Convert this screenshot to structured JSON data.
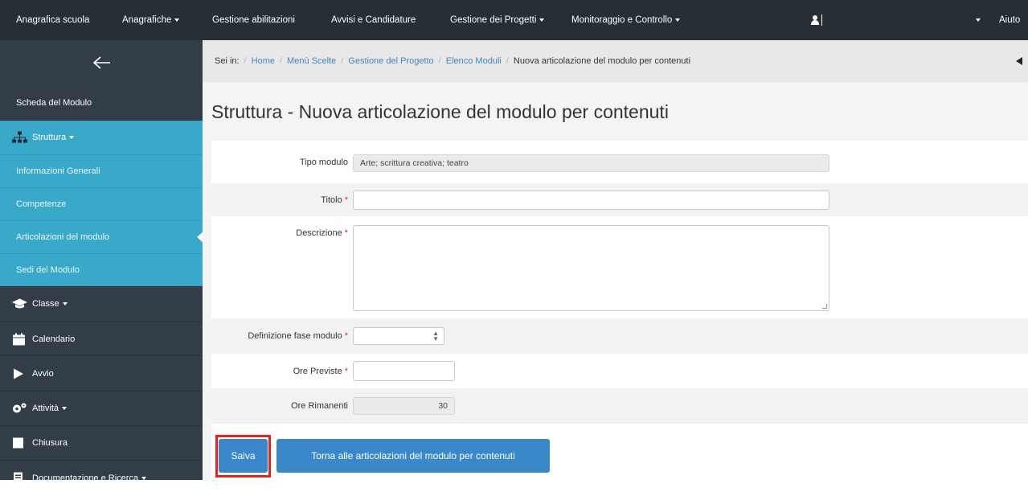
{
  "topnav": {
    "items": [
      {
        "label": "Anagrafica scuola",
        "dropdown": false
      },
      {
        "label": "Anagrafiche",
        "dropdown": true
      },
      {
        "label": "Gestione abilitazioni",
        "dropdown": false
      },
      {
        "label": "Avvisi e Candidature",
        "dropdown": false
      },
      {
        "label": "Gestione dei Progetti",
        "dropdown": true
      },
      {
        "label": "Monitoraggio e Controllo",
        "dropdown": true
      }
    ],
    "help_label": "Aiuto"
  },
  "sidebar": {
    "header_label": "Scheda del Modulo",
    "items": [
      {
        "label": "Struttura",
        "icon": "sitemap-icon",
        "dropdown": true
      },
      {
        "label": "Informazioni Generali"
      },
      {
        "label": "Competenze"
      },
      {
        "label": "Articolazioni del modulo"
      },
      {
        "label": "Sedi del Modulo"
      },
      {
        "label": "Classe",
        "icon": "graduation-cap-icon",
        "dropdown": true
      },
      {
        "label": "Calendario",
        "icon": "calendar-icon"
      },
      {
        "label": "Avvio",
        "icon": "play-icon"
      },
      {
        "label": "Attività",
        "icon": "cogs-icon",
        "dropdown": true
      },
      {
        "label": "Chiusura",
        "icon": "stop-icon"
      },
      {
        "label": "Documentazione e Ricerca",
        "icon": "book-icon",
        "dropdown": true
      }
    ]
  },
  "breadcrumb": {
    "prefix": "Sei in:",
    "items": [
      "Home",
      "Menù Scelte",
      "Gestione del Progetto",
      "Elenco Moduli",
      "Nuova articolazione del modulo per contenuti"
    ],
    "separator": "/"
  },
  "page_title": "Struttura - Nuova articolazione del modulo per contenuti",
  "form": {
    "tipo_modulo": {
      "label": "Tipo modulo",
      "value": "Arte; scrittura creativa; teatro"
    },
    "titolo": {
      "label": "Titolo",
      "required_mark": "*",
      "value": ""
    },
    "descrizione": {
      "label": "Descrizione",
      "required_mark": "*",
      "value": ""
    },
    "fase": {
      "label": "Definizione fase modulo",
      "required_mark": "*",
      "value": ""
    },
    "ore_previste": {
      "label": "Ore Previste",
      "required_mark": "*",
      "value": ""
    },
    "ore_rimanenti": {
      "label": "Ore Rimanenti",
      "value": "30"
    }
  },
  "buttons": {
    "save_label": "Salva",
    "back_label": "Torna alle articolazioni del modulo per contenuti"
  },
  "colors": {
    "topbar": "#262e36",
    "sidebar": "#333d47",
    "sidebar_active": "#39a9c9",
    "button": "#3a87c9",
    "highlight": "#e4241b",
    "required": "#e02a2a"
  }
}
